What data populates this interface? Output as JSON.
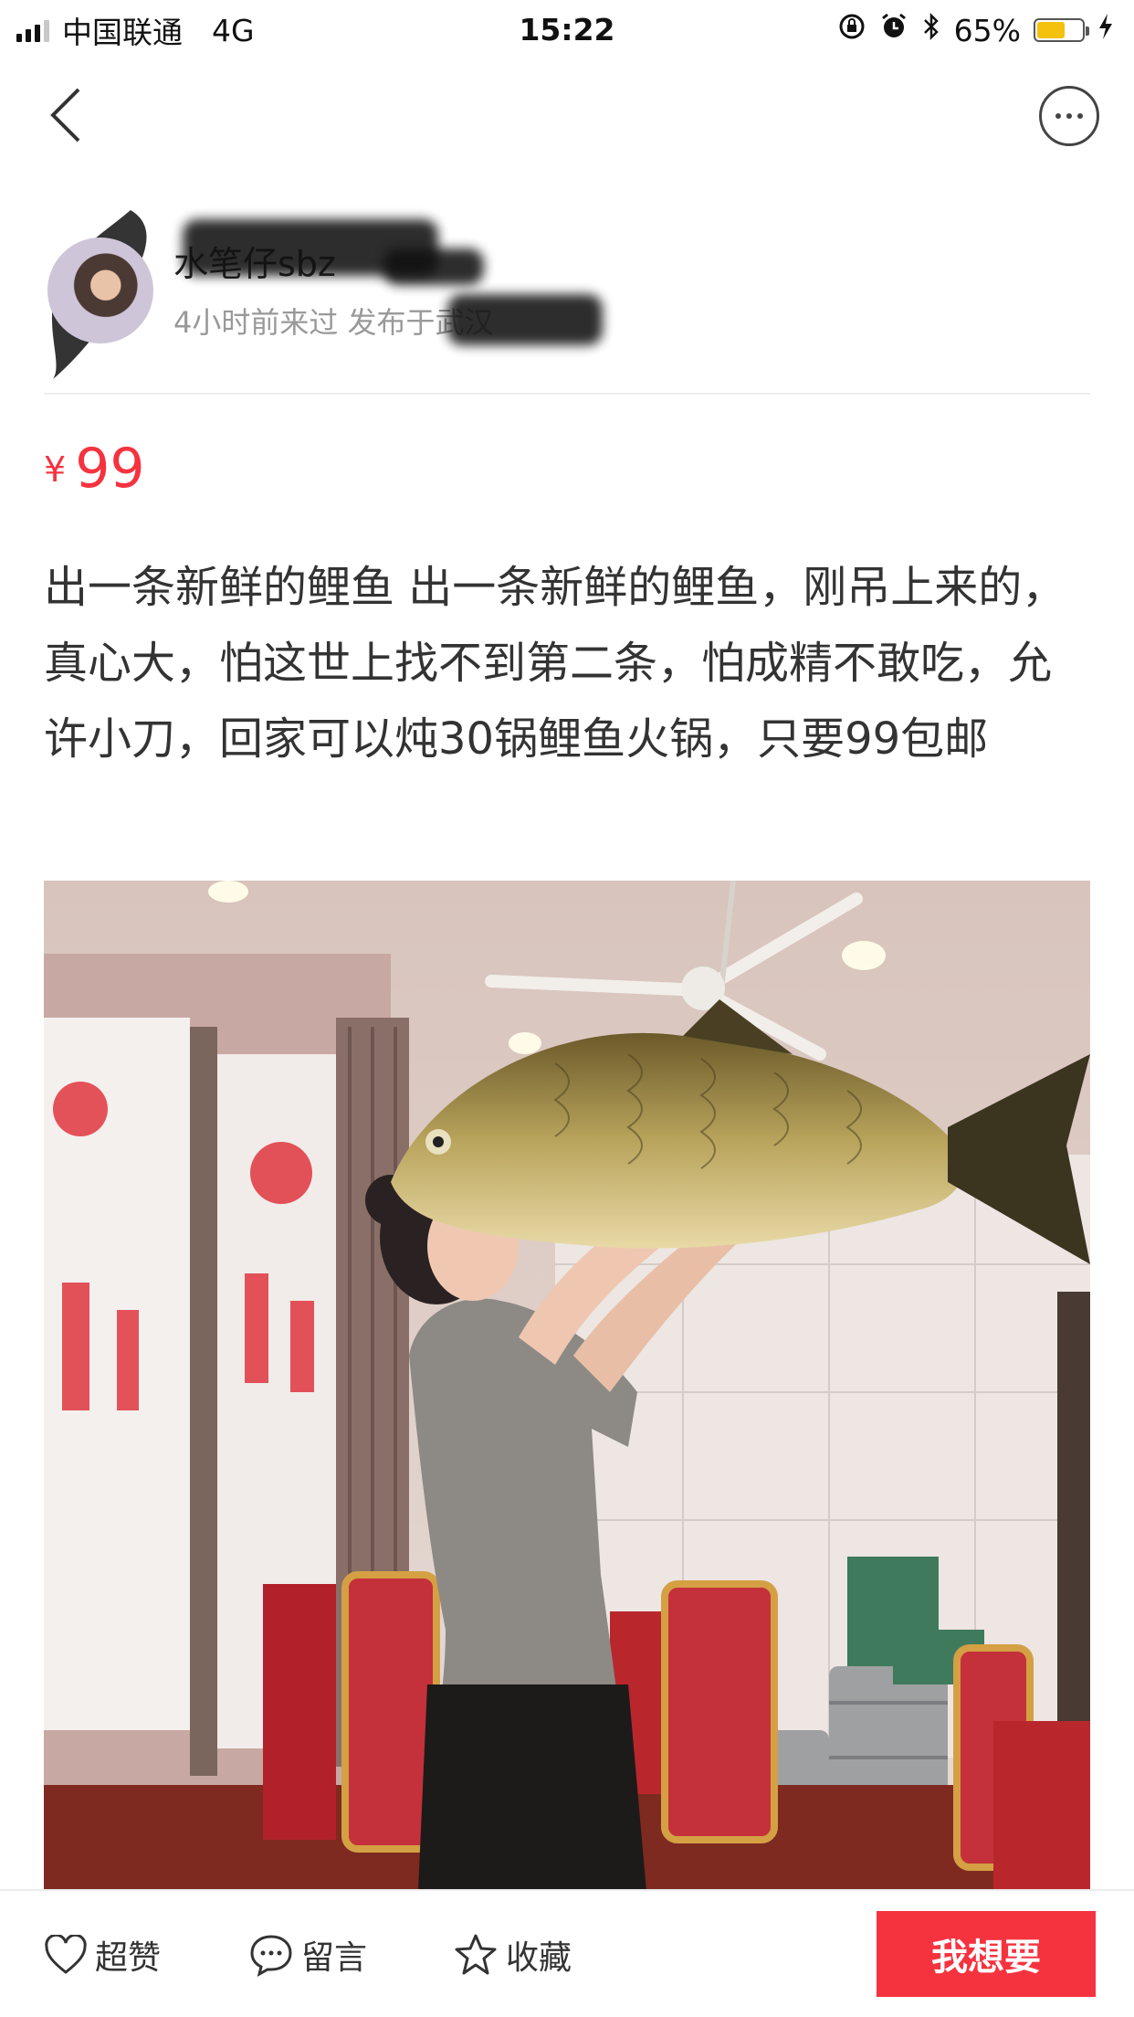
{
  "status_bar": {
    "carrier": "中国联通",
    "network": "4G",
    "time": "15:22",
    "battery": "65%",
    "battery_level": 0.65,
    "icons": [
      "signal-icon",
      "rotation-lock-icon",
      "alarm-icon",
      "bluetooth-icon",
      "battery-icon",
      "charging-icon"
    ]
  },
  "nav": {
    "back_icon": "chevron-left-icon",
    "more_icon": "more-dots-icon"
  },
  "seller": {
    "name": "水笔仔sbz",
    "meta": "4小时前来过 发布于武汉"
  },
  "item": {
    "currency": "¥",
    "price": "99",
    "description": "出一条新鲜的鲤鱼 出一条新鲜的鲤鱼，刚吊上来的，真心大，怕这世上找不到第二条，怕成精不敢吃，允许小刀，回家可以炖30锅鲤鱼火锅，只要99包邮"
  },
  "actions": {
    "like": "超赞",
    "comment": "留言",
    "favorite": "收藏",
    "want": "我想要"
  },
  "colors": {
    "accent": "#f5333f",
    "battery": "#f4c20d",
    "muted_text": "#999999"
  }
}
